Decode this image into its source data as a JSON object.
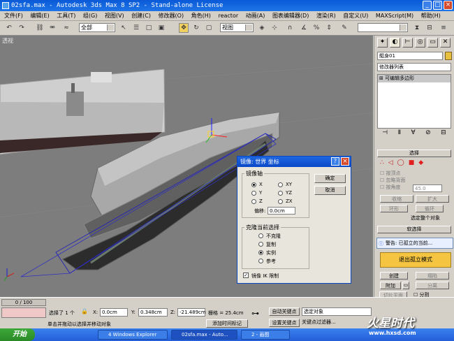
{
  "titlebar": {
    "title": "02sfa.max - Autodesk 3ds Max 8 SP2 - Stand-alone License"
  },
  "menu": [
    "文件(F)",
    "编辑(E)",
    "工具(T)",
    "组(G)",
    "视图(V)",
    "创建(C)",
    "修改器(O)",
    "角色(H)",
    "reactor",
    "动画(A)",
    "图表编辑器(D)",
    "渲染(R)",
    "自定义(U)",
    "MAXScript(M)",
    "帮助(H)"
  ],
  "toolbar": {
    "selection_filter": "全部",
    "ref_coord": "视图"
  },
  "viewport": {
    "label": "透视"
  },
  "cmd": {
    "object_name": "艇身01",
    "modifier_list": "修改器列表",
    "stack_item": "可编辑多边形",
    "selection_title": "选择",
    "by_vertex": "按顶点",
    "ignore_backface": "忽略背面",
    "by_angle": "按角度",
    "angle_value": "45.0",
    "shrink": "收缩",
    "grow": "扩大",
    "ring": "环形",
    "loop": "循环",
    "select_all_obj": "选定整个对象",
    "soft_sel": "软选择",
    "warning": "警告: 已孤立的当前...",
    "exit_isolate": "退出孤立模式",
    "create": "创建",
    "collapse": "塌陷",
    "attach": "附加",
    "detach": "分离",
    "slice_plane": "切片平面",
    "split": "分割"
  },
  "dialog": {
    "title": "镜像: 世界 坐标",
    "mirror_axis": "镜像轴",
    "axes": [
      "X",
      "Y",
      "Z",
      "XY",
      "YZ",
      "ZX"
    ],
    "offset_label": "偏移:",
    "offset_value": "0.0cm",
    "clone_title": "克隆当前选择",
    "clone_options": [
      "不克隆",
      "复制",
      "实例",
      "参考"
    ],
    "ik_label": "镜像 IK 限制",
    "ok": "确定",
    "cancel": "取消"
  },
  "status": {
    "time": "0 / 100",
    "selected": "选择了 1 个",
    "x_label": "X:",
    "x": "0.0cm",
    "y_label": "Y:",
    "y": "0.348cm",
    "z_label": "Z:",
    "z": "-21.489cm",
    "grid": "栅格 = 25.4cm",
    "autokey": "自动关键点",
    "setkey": "设置关键点",
    "sel_obj": "选定对象",
    "keyfilters": "关键点过滤器...",
    "prompt": "单击并拖动以选择并移动对象",
    "addtime": "添加时间标记"
  },
  "taskbar": {
    "start": "开始",
    "tasks": [
      "4 Windows Explorer",
      "02sfa.max - Auto...",
      "2 - 画图"
    ],
    "watermark": "火星时代",
    "watermark_url": "www.hxsd.com"
  },
  "colors": {
    "accent": "#0a5ad8",
    "viewport": "#7d7d7d",
    "exit_isolate": "#f5c542"
  }
}
